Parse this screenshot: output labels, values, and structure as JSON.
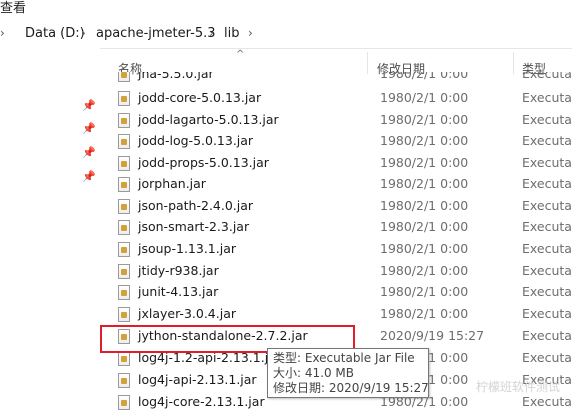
{
  "menu": {
    "view_label": "查看"
  },
  "breadcrumb": {
    "items": [
      "Data (D:)",
      "apache-jmeter-5.3",
      "lib"
    ]
  },
  "columns": {
    "name": "名称",
    "modified": "修改日期",
    "type": "类型"
  },
  "files": [
    {
      "name": "jna-5.5.0.jar",
      "date": "1980/2/1 0:00",
      "type": "Executab"
    },
    {
      "name": "jodd-core-5.0.13.jar",
      "date": "1980/2/1 0:00",
      "type": "Executab"
    },
    {
      "name": "jodd-lagarto-5.0.13.jar",
      "date": "1980/2/1 0:00",
      "type": "Executab"
    },
    {
      "name": "jodd-log-5.0.13.jar",
      "date": "1980/2/1 0:00",
      "type": "Executab"
    },
    {
      "name": "jodd-props-5.0.13.jar",
      "date": "1980/2/1 0:00",
      "type": "Executab"
    },
    {
      "name": "jorphan.jar",
      "date": "1980/2/1 0:00",
      "type": "Executab"
    },
    {
      "name": "json-path-2.4.0.jar",
      "date": "1980/2/1 0:00",
      "type": "Executab"
    },
    {
      "name": "json-smart-2.3.jar",
      "date": "1980/2/1 0:00",
      "type": "Executab"
    },
    {
      "name": "jsoup-1.13.1.jar",
      "date": "1980/2/1 0:00",
      "type": "Executab"
    },
    {
      "name": "jtidy-r938.jar",
      "date": "1980/2/1 0:00",
      "type": "Executab"
    },
    {
      "name": "junit-4.13.jar",
      "date": "1980/2/1 0:00",
      "type": "Executab"
    },
    {
      "name": "jxlayer-3.0.4.jar",
      "date": "1980/2/1 0:00",
      "type": "Executab"
    },
    {
      "name": "jython-standalone-2.7.2.jar",
      "date": "2020/9/19 15:27",
      "type": "Executab"
    },
    {
      "name": "log4j-1.2-api-2.13.1.jar",
      "date": "1980/2/1 0:00",
      "type": "Executab"
    },
    {
      "name": "log4j-api-2.13.1.jar",
      "date": "1980/2/1 0:00",
      "type": "Executab"
    },
    {
      "name": "log4j-core-2.13.1.jar",
      "date": "1980/2/1 0:00",
      "type": "Executab"
    }
  ],
  "tooltip": {
    "type_line": "类型: Executable Jar File",
    "size_line": "大小: 41.0 MB",
    "modified_line": "修改日期: 2020/9/19 15:27"
  },
  "watermark": "柠檬班软件测试",
  "colors": {
    "highlight": "#e11d2b"
  }
}
